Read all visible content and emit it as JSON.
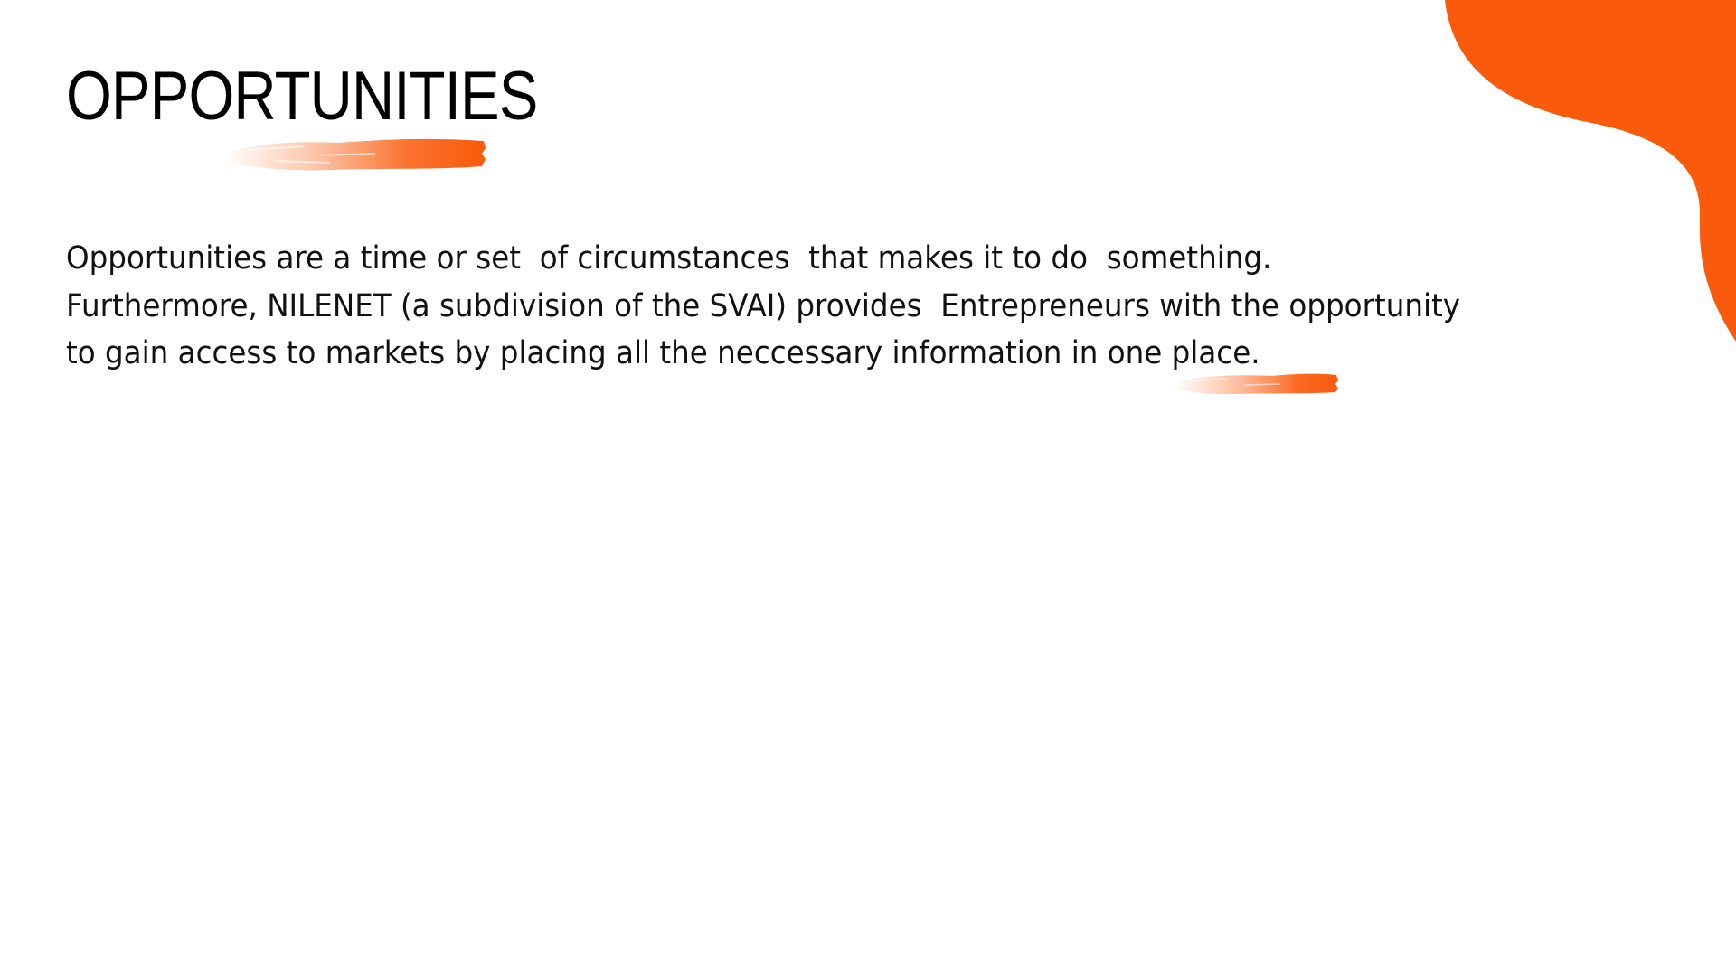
{
  "slide": {
    "title": "OPPORTUNITIES",
    "body_lines": [
      "Opportunities are a time or set  of circumstances  that makes it to do  something.",
      "Furthermore, NILENET (a subdivision of the SVAI) provides  Entrepreneurs with the opportunity",
      "to gain access to markets by placing all the neccessary information in one place."
    ]
  },
  "colors": {
    "accent": "#F95A0B",
    "text": "#111111",
    "background": "#FFFFFF"
  }
}
